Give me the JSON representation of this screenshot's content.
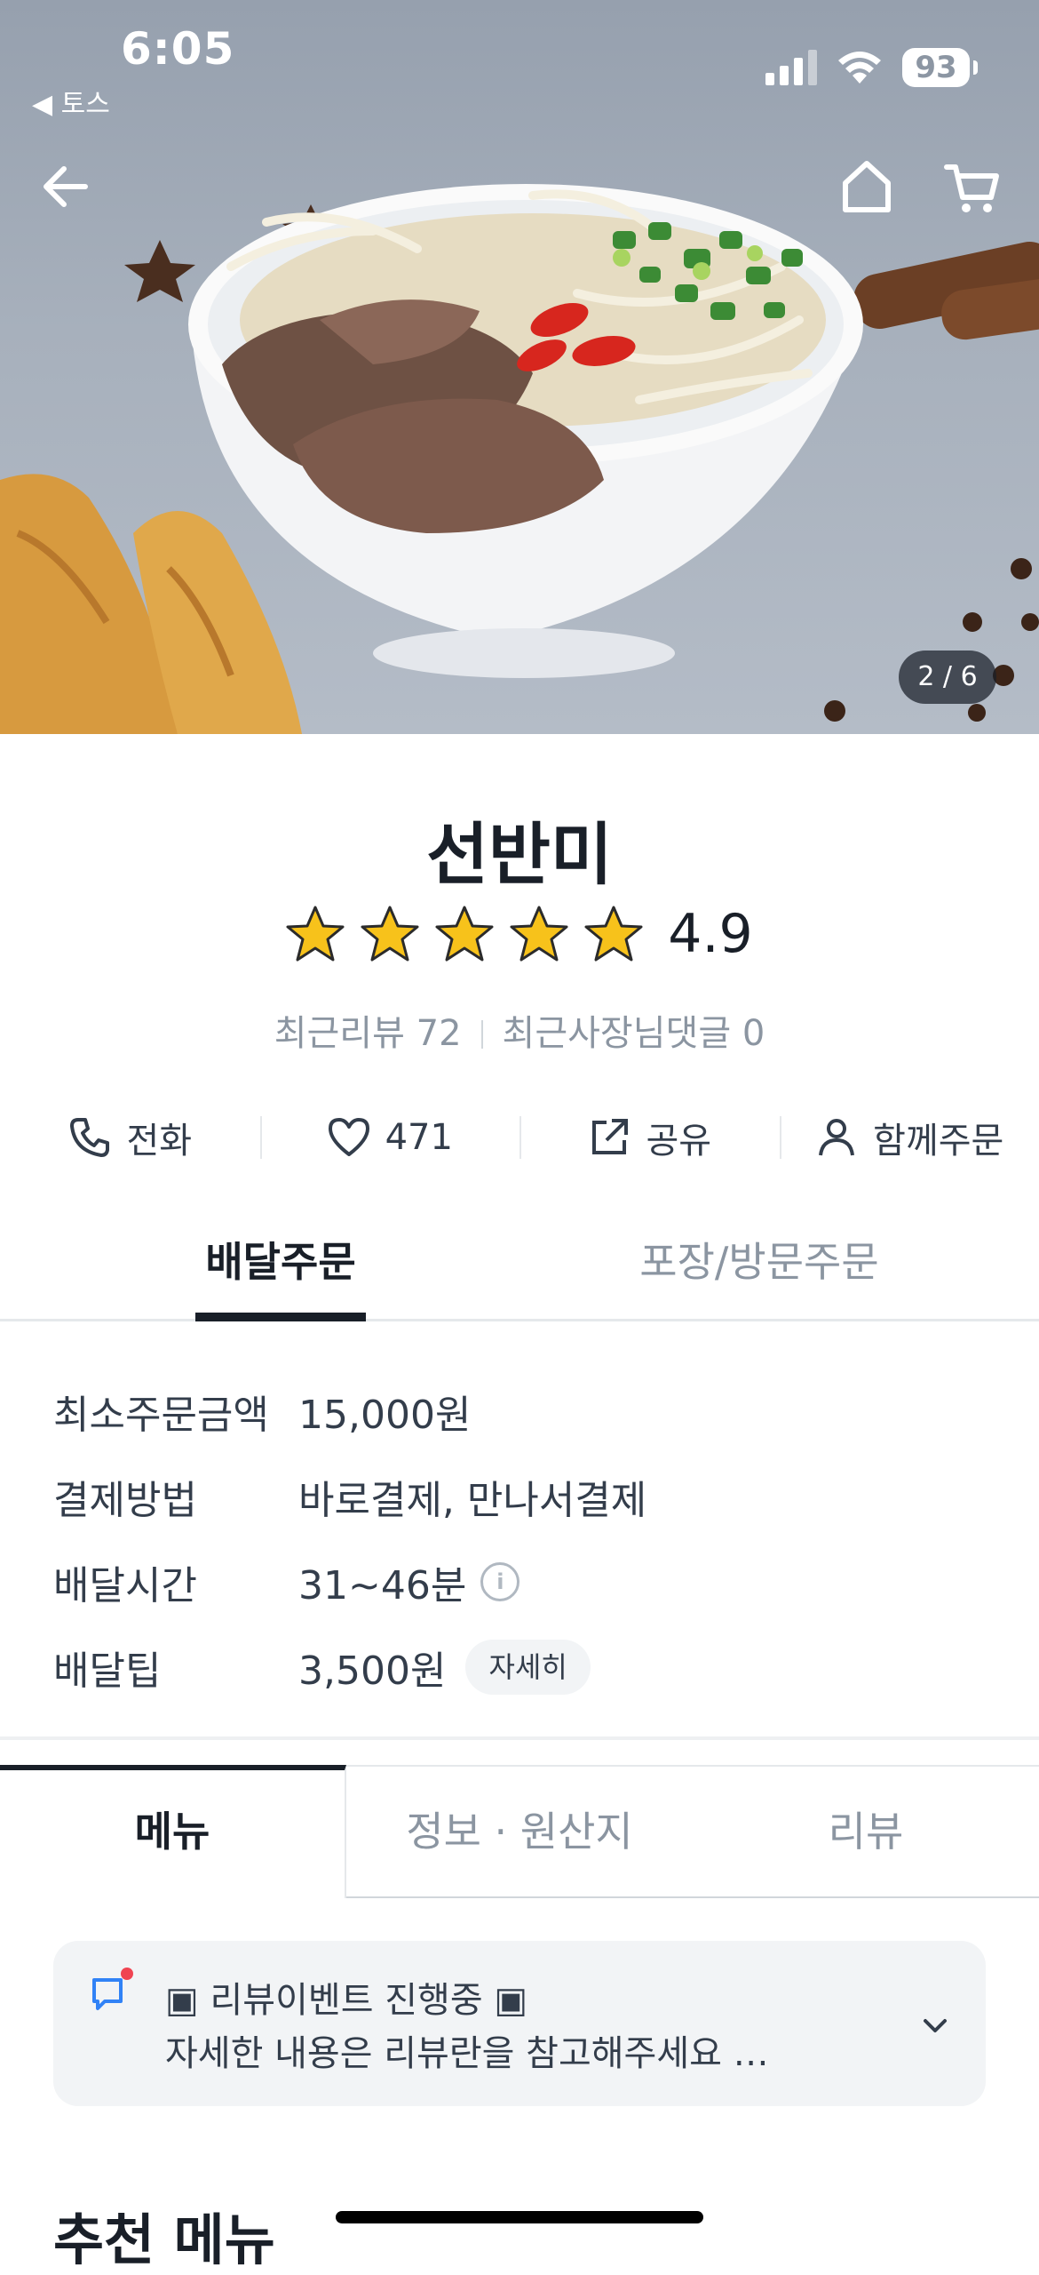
{
  "status_bar": {
    "time": "6:05",
    "back_app": "◀ 토스",
    "battery": "93"
  },
  "hero": {
    "page_indicator": "2 / 6"
  },
  "store": {
    "name": "선반미",
    "rating": "4.9",
    "stars": 5,
    "recent_reviews": "최근리뷰 72",
    "owner_replies": "최근사장님댓글 0"
  },
  "actions": [
    {
      "label": "전화",
      "icon": "phone-icon"
    },
    {
      "label": "471",
      "icon": "heart-icon"
    },
    {
      "label": "공유",
      "icon": "share-icon"
    },
    {
      "label": "함께주문",
      "icon": "person-icon"
    }
  ],
  "order_tabs": {
    "delivery": "배달주문",
    "pickup": "포장/방문주문"
  },
  "info": {
    "min_order_label": "최소주문금액",
    "min_order_value": "15,000원",
    "payment_label": "결제방법",
    "payment_value": "바로결제, 만나서결제",
    "time_label": "배달시간",
    "time_value": "31~46분",
    "tip_label": "배달팁",
    "tip_value": "3,500원",
    "tip_detail": "자세히"
  },
  "menu_tabs": {
    "menu": "메뉴",
    "info": "정보 · 원산지",
    "review": "리뷰"
  },
  "notice": {
    "title": "▣ 리뷰이벤트 진행중 ▣",
    "body": "자세한 내용은 리뷰란을 참고해주세요 ♪..."
  },
  "recommended_title": "추천 메뉴",
  "colors": {
    "accent": "#191f28",
    "gray_text": "#8b95a1",
    "notice_bg": "#f2f4f6",
    "star": "#f7c21b"
  }
}
